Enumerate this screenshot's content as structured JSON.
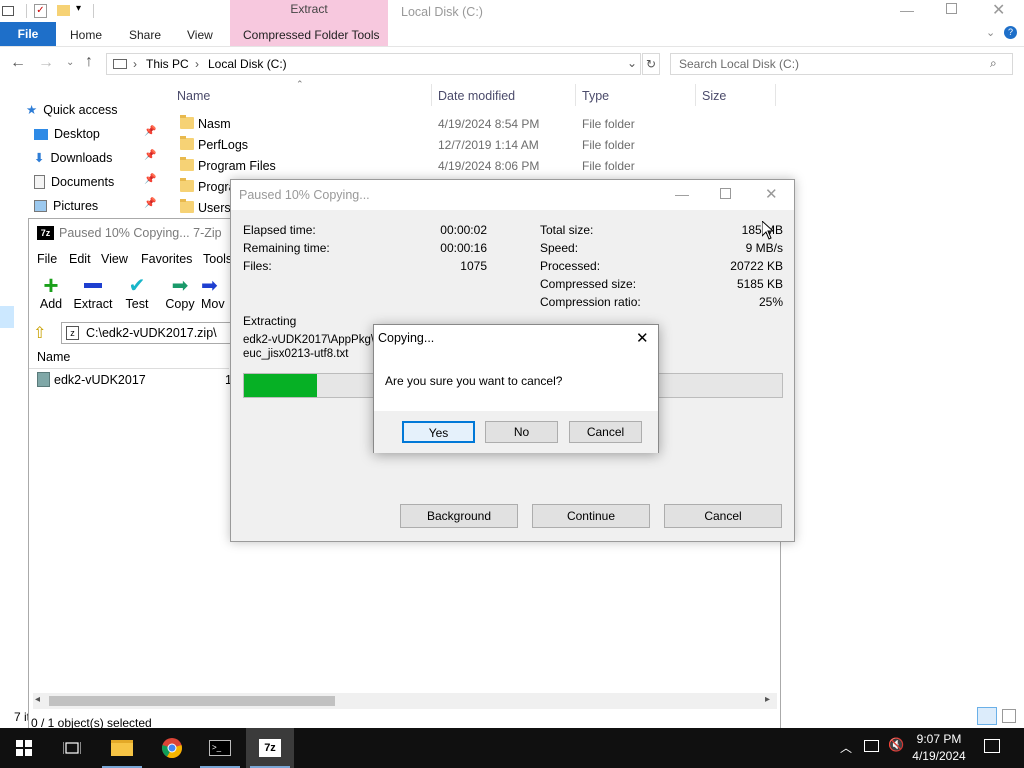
{
  "explorer": {
    "title": "Local Disk (C:)",
    "context_tab": "Extract",
    "tabs": [
      "File",
      "Home",
      "Share",
      "View",
      "Compressed Folder Tools"
    ],
    "breadcrumb": [
      "This PC",
      "Local Disk (C:)"
    ],
    "search_placeholder": "Search Local Disk (C:)",
    "nav": [
      {
        "label": "Quick access",
        "icon": "star-icon"
      },
      {
        "label": "Desktop",
        "icon": "desktop-icon"
      },
      {
        "label": "Downloads",
        "icon": "download-icon"
      },
      {
        "label": "Documents",
        "icon": "documents-icon"
      },
      {
        "label": "Pictures",
        "icon": "pictures-icon"
      }
    ],
    "columns": [
      "Name",
      "Date modified",
      "Type",
      "Size"
    ],
    "rows": [
      {
        "name": "Nasm",
        "date": "4/19/2024 8:54 PM",
        "type": "File folder"
      },
      {
        "name": "PerfLogs",
        "date": "12/7/2019 1:14 AM",
        "type": "File folder"
      },
      {
        "name": "Program Files",
        "date": "4/19/2024 8:06 PM",
        "type": "File folder"
      },
      {
        "name": "Progra",
        "date": "",
        "type": ""
      },
      {
        "name": "Users",
        "date": "",
        "type": ""
      }
    ],
    "status_fragment": "7 it"
  },
  "zip": {
    "title": "Paused 10% Copying... 7-Zip",
    "menu": [
      "File",
      "Edit",
      "View",
      "Favorites",
      "Tools"
    ],
    "toolbar": [
      "Add",
      "Extract",
      "Test",
      "Copy",
      "Mov"
    ],
    "path": "C:\\edk2-vUDK2017.zip\\",
    "column_name": "Name",
    "item": "edk2-vUDK2017",
    "item_fragment": "1",
    "status": "0 / 1 object(s) selected"
  },
  "progress": {
    "title": "Paused 10% Copying...",
    "elapsed_label": "Elapsed time:",
    "elapsed": "00:00:02",
    "remaining_label": "Remaining time:",
    "remaining": "00:00:16",
    "files_label": "Files:",
    "files": "1075",
    "total_label": "Total size:",
    "total": "185 MB",
    "speed_label": "Speed:",
    "speed": "9 MB/s",
    "processed_label": "Processed:",
    "processed": "20722 KB",
    "compressed_label": "Compressed size:",
    "compressed": "5185 KB",
    "ratio_label": "Compression ratio:",
    "ratio": "25%",
    "extracting_label": "Extracting",
    "file_line1": "edk2-vUDK2017\\AppPkg\\",
    "file_line2": "euc_jisx0213-utf8.txt",
    "progress_fraction": 0.135,
    "background_label": "Background",
    "continue_label": "Continue",
    "cancel_label": "Cancel"
  },
  "confirm": {
    "title": "Copying...",
    "message": "Are you sure you want to cancel?",
    "yes": "Yes",
    "no": "No",
    "cancel": "Cancel"
  },
  "taskbar": {
    "time": "9:07 PM",
    "date": "4/19/2024"
  },
  "colors": {
    "accent": "#1e6fc9",
    "context_tab": "#f7c8de",
    "progress": "#06b025",
    "taskbar": "#101010"
  }
}
